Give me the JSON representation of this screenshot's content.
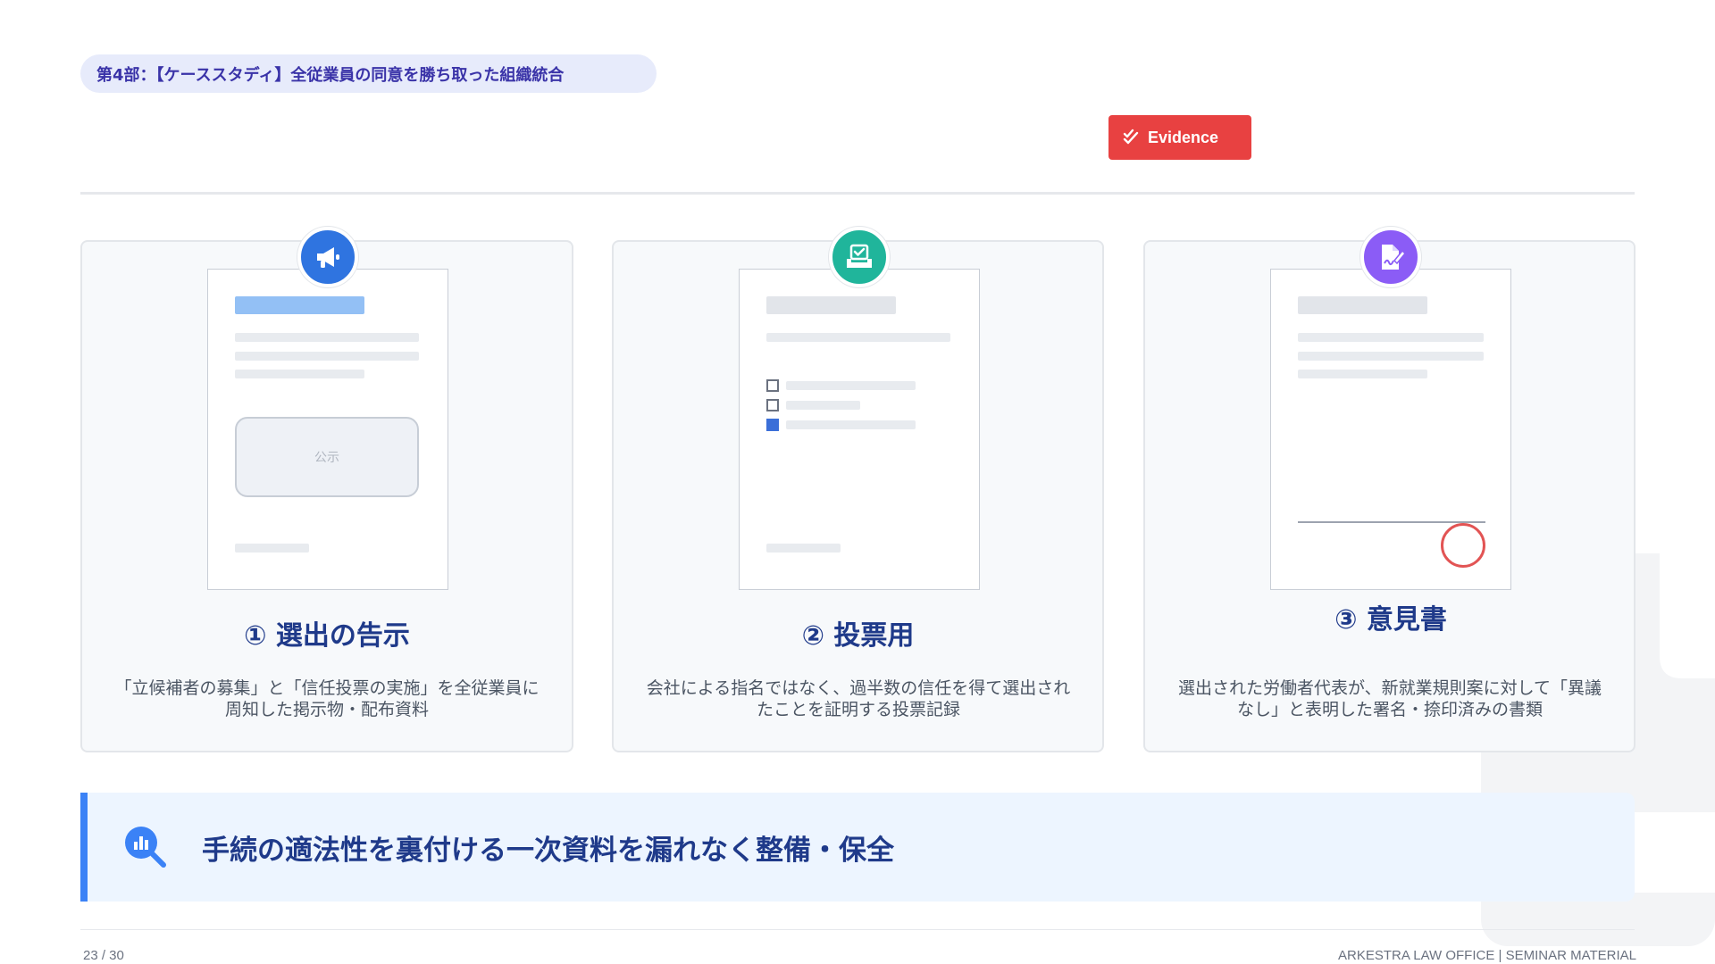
{
  "section_label": "第4部：【ケーススタディ】全従業員の同意を勝ち取った組織統合",
  "evidence_badge": {
    "label": "Evidence",
    "icon": "double-check-icon",
    "color": "#e84141"
  },
  "cards": [
    {
      "icon": "megaphone-icon",
      "icon_color": "#2f74e0",
      "title": "① 選出の告示",
      "description": "「立候補者の募集」と「信任投票の実施」を全従業員に周知した掲示物・配布資料",
      "doc_stamp_text": "公示"
    },
    {
      "icon": "ballot-box-icon",
      "icon_color": "#20b59b",
      "title": "② 投票用",
      "description": "会社による指名ではなく、過半数の信任を得て選出されたことを証明する投票記録"
    },
    {
      "icon": "signed-document-icon",
      "icon_color": "#8b5cf6",
      "title": "③ 意見書",
      "description": "選出された労働者代表が、新就業規則案に対して「異議なし」と表明した署名・捺印済みの書類"
    }
  ],
  "banner": {
    "icon": "magnifier-chart-icon",
    "text": "手続の適法性を裏付ける一次資料を漏れなく整備・保全"
  },
  "footer": {
    "page": "23 / 30",
    "credit": "ARKESTRA LAW OFFICE | SEMINAR MATERIAL"
  }
}
